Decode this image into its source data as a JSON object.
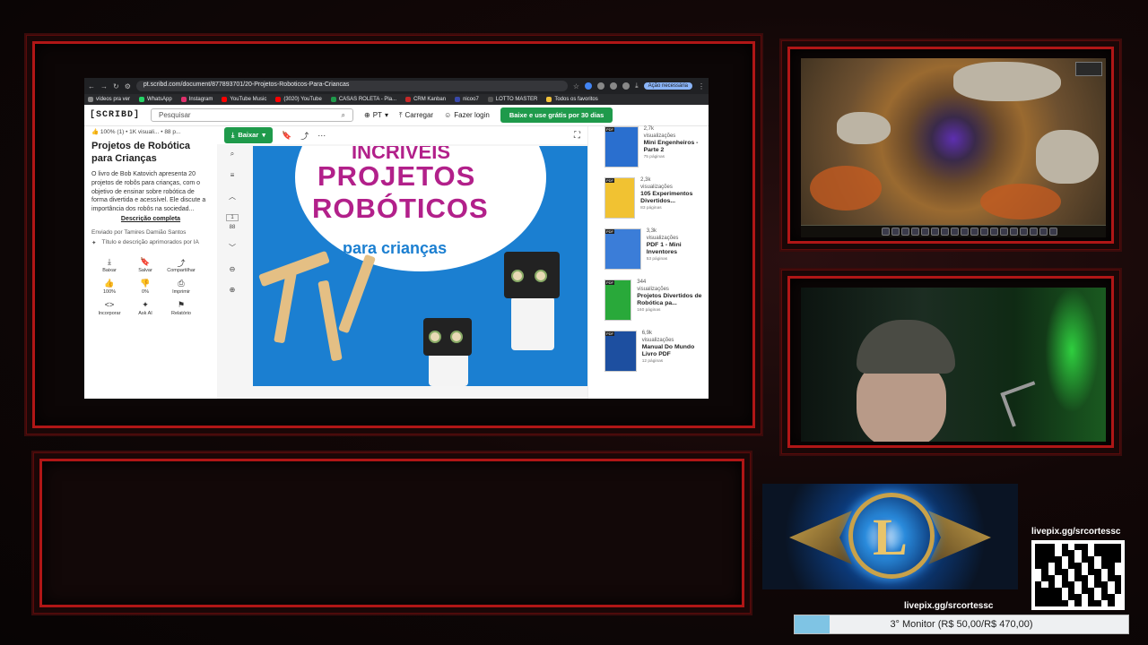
{
  "browser": {
    "url": "pt.scribd.com/document/877893701/20-Projetos-Roboticos-Para-Criancas",
    "ai_button": "Ação necessária",
    "bookmarks": [
      {
        "label": "vídeos pra ver",
        "color": "#888"
      },
      {
        "label": "WhatsApp",
        "color": "#25d366"
      },
      {
        "label": "Instagram",
        "color": "#e1306c"
      },
      {
        "label": "YouTube Music",
        "color": "#ff0000"
      },
      {
        "label": "(3020) YouTube",
        "color": "#ff0000"
      },
      {
        "label": "CASAS ROLETA - Pla...",
        "color": "#1f9a4b"
      },
      {
        "label": "CRM Kanban",
        "color": "#c62828"
      },
      {
        "label": "nicoo7",
        "color": "#3949ab"
      },
      {
        "label": "LOTTO MASTER",
        "color": "#555"
      },
      {
        "label": "Todos os favoritos",
        "color": "#f3c23a"
      }
    ]
  },
  "scribd": {
    "logo": "[SCRIBD]",
    "search_placeholder": "Pesquisar",
    "lang": "PT",
    "upload": "Carregar",
    "login": "Fazer login",
    "cta": "Baixe e use grátis por 30 dias",
    "stats": {
      "rating": "100% (1)",
      "views": "1K visuali...",
      "pages": "88 p..."
    },
    "title": "Projetos de Robótica para Crianças",
    "description": "O livro de Bob Katovich apresenta 20 projetos de robôs para crianças, com o objetivo de ensinar sobre robótica de forma divertida e acessível. Ele discute a importância dos robôs na sociedad...",
    "description_link": "Descrição completa",
    "sent_by": "Enviado por Tamires Damião Santos",
    "ai_note": "Título e descrição aprimorados por IA",
    "actions": [
      {
        "icon": "⤓",
        "label": "Baixar",
        "name": "download-action"
      },
      {
        "icon": "🔖",
        "label": "Salvar",
        "name": "save-action"
      },
      {
        "icon": "⤴",
        "label": "Compartilhar",
        "name": "share-action"
      },
      {
        "icon": "👍",
        "label": "100%",
        "name": "like-action"
      },
      {
        "icon": "👎",
        "label": "0%",
        "name": "dislike-action"
      },
      {
        "icon": "⎙",
        "label": "Imprimir",
        "name": "print-action"
      },
      {
        "icon": "<>",
        "label": "Incorporar",
        "name": "embed-action"
      },
      {
        "icon": "✦",
        "label": "Ask AI",
        "name": "ask-ai-action"
      },
      {
        "icon": "⚑",
        "label": "Relatório",
        "name": "report-action"
      }
    ],
    "viewer": {
      "download": "Baixar",
      "page_current": "1",
      "page_total": "88",
      "cover_line1": "INCRÍVEIS",
      "cover_line2": "PROJETOS",
      "cover_line3": "ROBÓTICOS",
      "cover_line4": "para crianças"
    },
    "recommendations": [
      {
        "views": "2,7k",
        "views_label": "visualizações",
        "title": "Mini Engenheiros - Parte 2",
        "pages": "75 páginas",
        "color": "#2a6fcf"
      },
      {
        "views": "2,3k",
        "views_label": "visualizações",
        "title": "105 Experimentos Divertidos...",
        "pages": "83 páginas",
        "color": "#f1c232"
      },
      {
        "views": "3,3k",
        "views_label": "visualizações",
        "title": "PDF 1 - Mini Inventores",
        "pages": "53 páginas",
        "color": "#3b7dd8"
      },
      {
        "views": "344",
        "views_label": "visualizações",
        "title": "Projetos Divertidos de Robótica pa...",
        "pages": "160 páginas",
        "color": "#29a93a"
      },
      {
        "views": "6,9k",
        "views_label": "visualizações",
        "title": "Manual Do Mundo Livro PDF",
        "pages": "12 páginas",
        "color": "#1d4fa0"
      }
    ]
  },
  "overlay": {
    "livepix_top": "livepix.gg/srcortessc",
    "livepix_bottom": "livepix.gg/srcortessc",
    "goal_label": "3° Monitor (R$ 50,00/R$ 470,00)",
    "goal_progress": 0.106
  }
}
